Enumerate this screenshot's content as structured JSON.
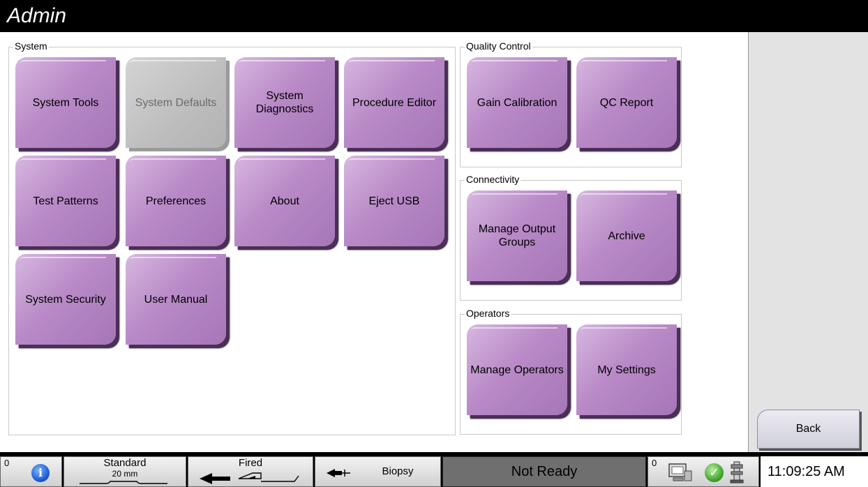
{
  "window": {
    "title": "Admin"
  },
  "groups": {
    "system": {
      "label": "System",
      "tiles": [
        {
          "label": "System Tools",
          "disabled": false
        },
        {
          "label": "System Defaults",
          "disabled": true
        },
        {
          "label": "System Diagnostics",
          "disabled": false
        },
        {
          "label": "Procedure Editor",
          "disabled": false
        },
        {
          "label": "Test Patterns",
          "disabled": false
        },
        {
          "label": "Preferences",
          "disabled": false
        },
        {
          "label": "About",
          "disabled": false
        },
        {
          "label": "Eject USB",
          "disabled": false
        },
        {
          "label": "System Security",
          "disabled": false
        },
        {
          "label": "User Manual",
          "disabled": false
        }
      ]
    },
    "quality_control": {
      "label": "Quality Control",
      "tiles": [
        {
          "label": "Gain Calibration"
        },
        {
          "label": "QC Report"
        }
      ]
    },
    "connectivity": {
      "label": "Connectivity",
      "tiles": [
        {
          "label": "Manage Output Groups"
        },
        {
          "label": "Archive"
        }
      ]
    },
    "operators": {
      "label": "Operators",
      "tiles": [
        {
          "label": "Manage Operators"
        },
        {
          "label": "My Settings"
        }
      ]
    }
  },
  "back_button": {
    "label": "Back"
  },
  "taskbar": {
    "left_count": "0",
    "info_icon": "info-icon",
    "paddle": {
      "name": "Standard",
      "size": "20 mm"
    },
    "fired": {
      "label": "Fired"
    },
    "biopsy": {
      "label": "Biopsy"
    },
    "status": {
      "label": "Not Ready"
    },
    "right_count": "0",
    "time": "11:09:25 AM",
    "colors": {
      "status_bg": "#6f6f6f",
      "tile": "#b98ac7",
      "ok": "#3ea12a"
    }
  }
}
